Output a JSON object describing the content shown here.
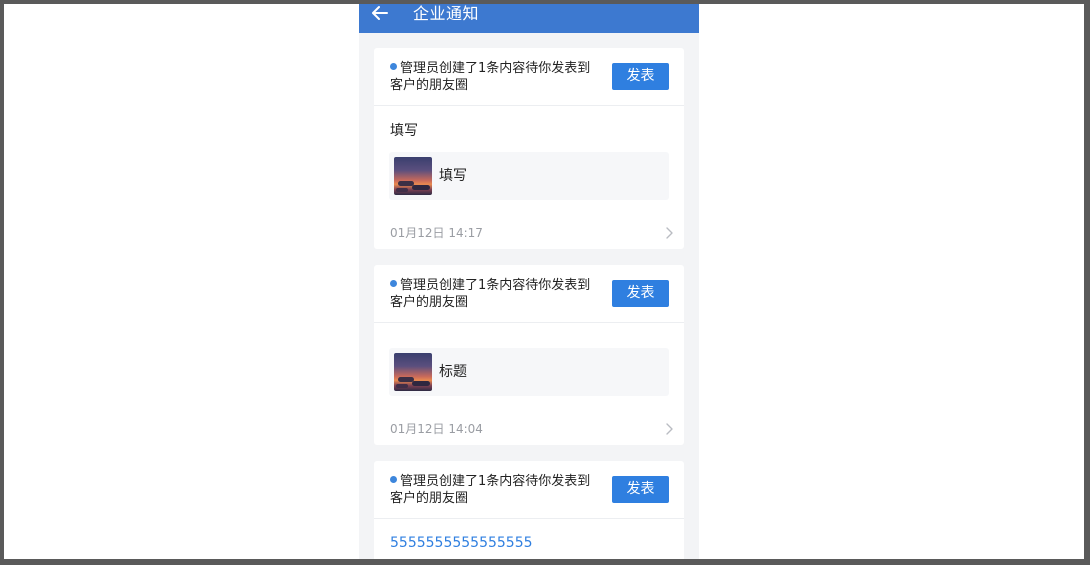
{
  "header": {
    "title": "企业通知",
    "back_icon": "arrow-left-icon"
  },
  "colors": {
    "header_bg": "#3d79d0",
    "button_bg": "#2f7fe0",
    "dot": "#3d86dc",
    "link": "#2f7fe0",
    "time": "#9a9da3",
    "page_bg": "#f3f4f6"
  },
  "notifications": [
    {
      "message": "管理员创建了1条内容待你发表到客户的朋友圈",
      "action_label": "发表",
      "content_text": "填写",
      "attachment_title": "填写",
      "time": "01月12日 14:17"
    },
    {
      "message": "管理员创建了1条内容待你发表到客户的朋友圈",
      "action_label": "发表",
      "attachment_title": "标题",
      "time": "01月12日 14:04"
    },
    {
      "message": "管理员创建了1条内容待你发表到客户的朋友圈",
      "action_label": "发表",
      "content_text": "5555555555555555"
    }
  ]
}
